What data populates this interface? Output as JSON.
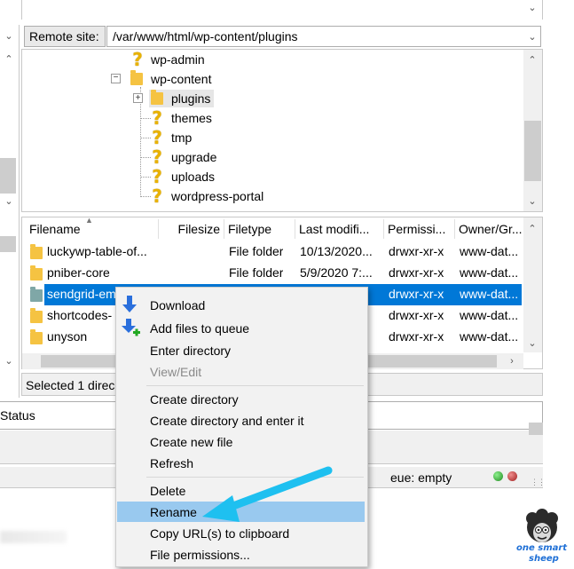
{
  "remote_site": {
    "label": "Remote site:",
    "path": "/var/www/html/wp-content/plugins"
  },
  "tree": {
    "items": [
      {
        "name": "wp-admin",
        "icon": "question-icon"
      },
      {
        "name": "wp-content",
        "icon": "folder-icon"
      },
      {
        "name": "plugins",
        "icon": "folder-icon"
      },
      {
        "name": "themes",
        "icon": "question-icon"
      },
      {
        "name": "tmp",
        "icon": "question-icon"
      },
      {
        "name": "upgrade",
        "icon": "question-icon"
      },
      {
        "name": "uploads",
        "icon": "question-icon"
      },
      {
        "name": "wordpress-portal",
        "icon": "question-icon"
      }
    ],
    "expander_minus": "−",
    "expander_plus": "+"
  },
  "file_list": {
    "columns": [
      "Filename",
      "Filesize",
      "Filetype",
      "Last modifi...",
      "Permissi...",
      "Owner/Gr..."
    ],
    "rows": [
      {
        "name": "luckywp-table-of...",
        "size": "",
        "type": "File folder",
        "modified": "10/13/2020...",
        "perm": "drwxr-xr-x",
        "owner": "www-dat..."
      },
      {
        "name": "pniber-core",
        "size": "",
        "type": "File folder",
        "modified": "5/9/2020 7:...",
        "perm": "drwxr-xr-x",
        "owner": "www-dat..."
      },
      {
        "name": "sendgrid-em",
        "size": "",
        "type": "",
        "modified": "",
        "perm": "drwxr-xr-x",
        "owner": "www-dat..."
      },
      {
        "name": "shortcodes-",
        "size": "",
        "type": "",
        "modified": "",
        "perm": "drwxr-xr-x",
        "owner": "www-dat..."
      },
      {
        "name": "unyson",
        "size": "",
        "type": "",
        "modified": "",
        "perm": "drwxr-xr-x",
        "owner": "www-dat..."
      }
    ],
    "selected_status": "Selected 1 direc"
  },
  "status_panel": {
    "label": "Status"
  },
  "queue_status": "eue: empty",
  "context_menu": {
    "items": [
      {
        "label": "Download",
        "disabled": false
      },
      {
        "label": "Add files to queue",
        "disabled": false
      },
      {
        "label": "Enter directory",
        "disabled": false
      },
      {
        "label": "View/Edit",
        "disabled": true
      },
      {
        "label": "Create directory",
        "disabled": false
      },
      {
        "label": "Create directory and enter it",
        "disabled": false
      },
      {
        "label": "Create new file",
        "disabled": false
      },
      {
        "label": "Refresh",
        "disabled": false
      },
      {
        "label": "Delete",
        "disabled": false
      },
      {
        "label": "Rename",
        "disabled": false,
        "highlighted": true
      },
      {
        "label": "Copy URL(s) to clipboard",
        "disabled": false
      },
      {
        "label": "File permissions...",
        "disabled": false
      }
    ]
  },
  "logo": {
    "line1": "one smart",
    "line2": "sheep"
  },
  "colors": {
    "selection": "#0078d7",
    "menu_highlight": "#99c9ef",
    "arrow": "#1ec0f0",
    "folder": "#f5c342"
  }
}
